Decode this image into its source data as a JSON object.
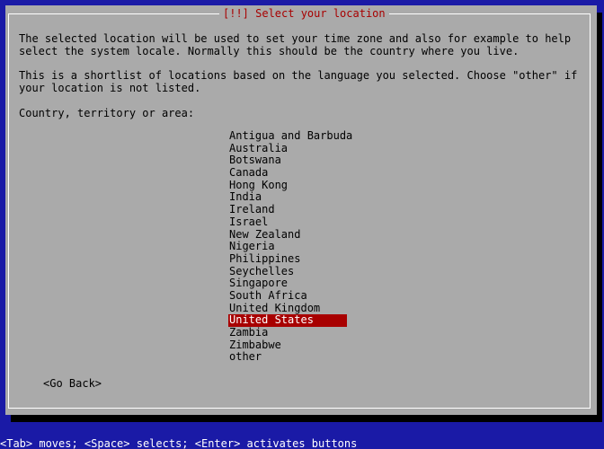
{
  "dialog": {
    "title": "[!!] Select your location",
    "intro_line1": "The selected location will be used to set your time zone and also for example to help",
    "intro_line2": "select the system locale. Normally this should be the country where you live.",
    "shortlist_line1": "This is a shortlist of locations based on the language you selected. Choose \"other\" if",
    "shortlist_line2": "your location is not listed.",
    "prompt": "Country, territory or area:",
    "locations": [
      "Antigua and Barbuda",
      "Australia",
      "Botswana",
      "Canada",
      "Hong Kong",
      "India",
      "Ireland",
      "Israel",
      "New Zealand",
      "Nigeria",
      "Philippines",
      "Seychelles",
      "Singapore",
      "South Africa",
      "United Kingdom",
      "United States",
      "Zambia",
      "Zimbabwe",
      "other"
    ],
    "selected_location": "United States",
    "go_back_label": "<Go Back>"
  },
  "status_bar": {
    "help_text": "<Tab> moves; <Space> selects; <Enter> activates buttons"
  },
  "colors": {
    "background": "#1a1aa6",
    "dialog": "#aaaaaa",
    "selection": "#a80000",
    "title_text": "#a80000"
  }
}
